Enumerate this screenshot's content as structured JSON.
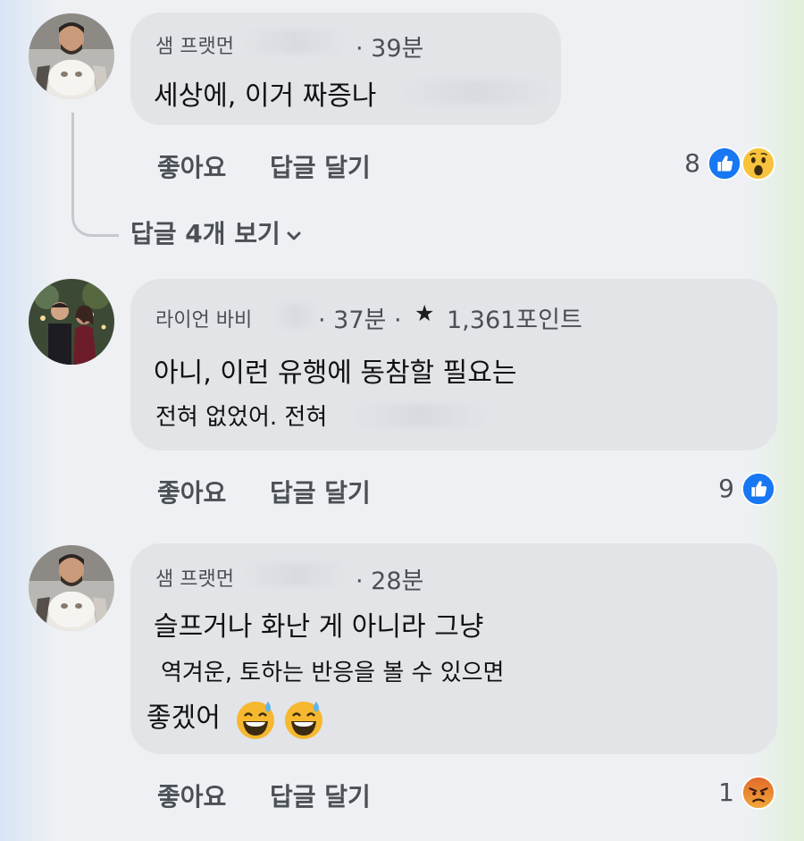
{
  "comments": [
    {
      "author": "샘 프랫먼",
      "time": "· 39분",
      "lines": [
        "세상에, 이거 짜증나"
      ],
      "like_label": "좋아요",
      "reply_label": "답글 달기",
      "reaction_count": "8",
      "reactions": [
        "like-icon",
        "wow-icon"
      ]
    },
    {
      "author": "라이언 바비",
      "time": "· 37분 ·",
      "points": "1,361포인트",
      "lines": [
        "아니, 이런 유행에 동참할 필요는",
        "전혀 없었어. 전혀"
      ],
      "like_label": "좋아요",
      "reply_label": "답글 달기",
      "reaction_count": "9",
      "reactions": [
        "like-icon"
      ]
    },
    {
      "author": "샘 프랫먼",
      "time": "· 28분",
      "lines": [
        "슬프거나 화난 게 아니라 그냥",
        "역겨운, 토하는 반응을 볼 수 있으면",
        "좋겠어"
      ],
      "line_emojis": [
        "sweat-smile-emoji",
        "sweat-smile-emoji"
      ],
      "like_label": "좋아요",
      "reply_label": "답글 달기",
      "reaction_count": "1",
      "reactions": [
        "angry-icon"
      ]
    }
  ],
  "view_replies": "답글 4개 보기",
  "colors": {
    "bubble": "#e2e4e8",
    "like_blue": "#1877f2",
    "wow_yellow": "#f7c33c",
    "angry_orange": "#e0682b",
    "secondary_text": "#4b4f56"
  }
}
